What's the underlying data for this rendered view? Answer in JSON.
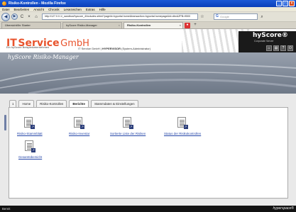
{
  "window": {
    "title": "Risiko-Kontrollen - Mozilla Firefox"
  },
  "menu": [
    "Datei",
    "Bearbeiten",
    "Ansicht",
    "Chronik",
    "Lesezeichen",
    "Extras",
    "Hilfe"
  ],
  "nav": {
    "url": "http://127.0.0.1/_sandbox/hyscore_4/includes.shtml?pageId=hyportal.home&transaction=hyportal.homepage&id=dbx&ZPB=9500",
    "search_placeholder": "Google",
    "search_icon_label": "G"
  },
  "browser_tabs": [
    {
      "label": "Übersicht/Ihr Starter"
    },
    {
      "label": "hyScore Risiko-Manager"
    },
    {
      "label": "Risiko-Kontrollen",
      "active": true
    }
  ],
  "app": {
    "logo_it": "IT",
    "logo_service": "Service",
    "logo_gmbh": "GmbH",
    "logo_tagline": "Ein hyScore Beispielunternehmen",
    "user_company": "IT Service GmbH |",
    "user_name": "HYPERVISOR",
    "user_role": "(System-Administrator)",
    "brand_name": "hyScore®",
    "brand_sub": "Corporate Server",
    "title": "hyScore Risiko-Manager"
  },
  "tabs": [
    {
      "label": "1"
    },
    {
      "label": "Home"
    },
    {
      "label": "Risiko-Kontrollen"
    },
    {
      "label": "Berichte",
      "active": true
    },
    {
      "label": "Stammdaten & Einstellungen"
    }
  ],
  "reports": [
    {
      "label": "Risiko-Stammblatt"
    },
    {
      "label": "Risiko-Inventar"
    },
    {
      "label": "Sortierte Liste der Risiken"
    },
    {
      "label": "Status der Risikokontrollen"
    },
    {
      "label": "Gesamtübersicht"
    }
  ],
  "status": {
    "text": "Bereit",
    "brand": "hyperspace®"
  },
  "colors": {
    "logo": "#e8532c",
    "band": "#8a93a1",
    "link": "#2546a8"
  }
}
